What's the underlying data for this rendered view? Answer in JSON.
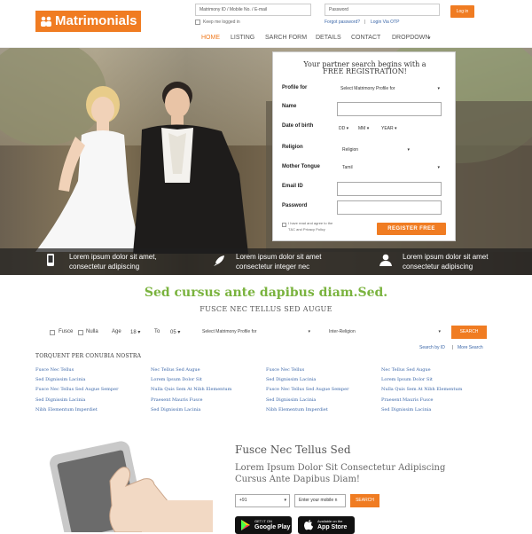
{
  "header": {
    "logo_text": "Matrimonials",
    "login_id_placeholder": "Matrimony ID / Mobile No. / E-mail",
    "password_placeholder": "Password",
    "keep_logged": "Keep me logged in",
    "forgot": "Forgot password?",
    "separator": "|",
    "otp": "Login Via OTP",
    "login_button": "Log in"
  },
  "nav": {
    "items": [
      "HOME",
      "LISTING",
      "SARCH FORM",
      "DETAILS",
      "CONTACT",
      "DROPDOWN"
    ]
  },
  "form": {
    "title_line1": "Your partner search begins with a",
    "title_line2": "FREE REGISTRATION!",
    "profile_for_label": "Profile for",
    "profile_for_value": "Select Matrimony Profile for",
    "name_label": "Name",
    "dob_label": "Date of birth",
    "dd": "DD",
    "mm": "MM",
    "year": "YEAR",
    "religion_label": "Religion",
    "religion_value": "Religion",
    "mother_tongue_label": "Mother Tongue",
    "mother_tongue_value": "Tamil",
    "email_label": "Email ID",
    "password_label": "Password",
    "agree_line1": "I have read and agree to the",
    "agree_line2": "T&C and Privacy Policy",
    "register_button": "REGISTER FREE"
  },
  "features": [
    {
      "icon": "mobile-icon",
      "line1": "Lorem ipsum dolor sit amet,",
      "line2": "consectetur adipiscing"
    },
    {
      "icon": "rocket-icon",
      "line1": "Lorem ipsum dolor sit amet",
      "line2": "consectetur integer nec"
    },
    {
      "icon": "user-icon",
      "line1": "Lorem ipsum dolor sit amet",
      "line2": "consectetur adipiscing"
    }
  ],
  "search": {
    "title": "Sed cursus ante dapibus diam.Sed.",
    "subtitle": "FUSCE NEC TELLUS SED AUGUE",
    "fusce": "Fusce",
    "nulla": "Nulla",
    "age": "Age",
    "age_from": "18",
    "to": "To",
    "age_to": "05",
    "profile_value": "Select Matrimony Profile for",
    "religion_value": "Inter-Religion",
    "button": "SEARCH",
    "by_id": "Search by ID",
    "sep": "|",
    "more": "More Search"
  },
  "links": {
    "heading": "TORQUENT PER CONUBIA NOSTRA",
    "columns": [
      [
        "Fusce Nec Tellus",
        "Sed Dignissim Lacinia",
        "Fusce Nec Tellus Sed Augue Semper",
        "Sed Dignissim Lacinia",
        "Nibh Elementum Imperdiet"
      ],
      [
        "Nec Tellus Sed Augue",
        "Lorem Ipsum Dolor Sit",
        "Nulla Quis Sem At Nibh Elementum",
        "Praesent Mauris Fusce",
        "Sed Dignissim Lacinia"
      ],
      [
        "Fusce Nec Tellus",
        "Sed Dignissim Lacinia",
        "Fusce Nec Tellus Sed Augue Semper",
        "Sed Dignissim Lacinia",
        "Nibh Elementum Imperdiet"
      ],
      [
        "Nec Tellus Sed Augue",
        "Lorem Ipsum Dolor Sit",
        "Nulla Quis Sem At Nibh Elementum",
        "Praesent Mauris Fusce",
        "Sed Dignissim Lacinia"
      ]
    ]
  },
  "app": {
    "title": "Fusce Nec Tellus Sed",
    "subtitle_line1": "Lorem Ipsum Dolor Sit Consectetur Adipiscing",
    "subtitle_line2": "Cursus Ante Dapibus Diam!",
    "country_code": "+91",
    "mobile_placeholder": "Enter your mobile n",
    "button": "SEARCH",
    "google_small": "GET IT ON",
    "google_big": "Google Play",
    "apple_small": "Available on the",
    "apple_big": "App Store"
  },
  "colors": {
    "accent": "#f07c22",
    "green": "#7ab33e",
    "link": "#3a66a8"
  }
}
